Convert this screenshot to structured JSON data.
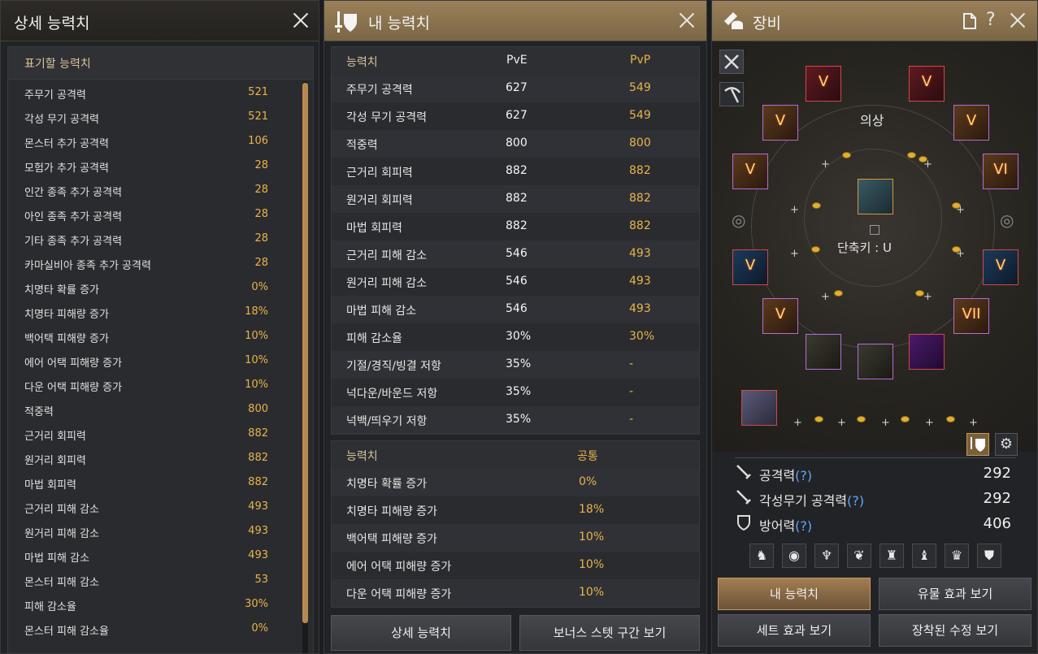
{
  "detail_panel": {
    "title": "상세 능력치",
    "section_label": "표기할 능력치",
    "rows": [
      {
        "name": "주무기 공격력",
        "value": "521"
      },
      {
        "name": "각성 무기 공격력",
        "value": "521"
      },
      {
        "name": "몬스터 추가 공격력",
        "value": "106"
      },
      {
        "name": "모험가 추가 공격력",
        "value": "28"
      },
      {
        "name": "인간 종족 추가 공격력",
        "value": "28"
      },
      {
        "name": "아인 종족 추가 공격력",
        "value": "28"
      },
      {
        "name": "기타 종족 추가 공격력",
        "value": "28"
      },
      {
        "name": "카마실비아 종족 추가 공격력",
        "value": "28"
      },
      {
        "name": "치명타 확률 증가",
        "value": "0%"
      },
      {
        "name": "치명타 피해량 증가",
        "value": "18%"
      },
      {
        "name": "백어택 피해량 증가",
        "value": "10%"
      },
      {
        "name": "에어 어택 피해량 증가",
        "value": "10%"
      },
      {
        "name": "다운 어택 피해량 증가",
        "value": "10%"
      },
      {
        "name": "적중력",
        "value": "800"
      },
      {
        "name": "근거리 회피력",
        "value": "882"
      },
      {
        "name": "원거리 회피력",
        "value": "882"
      },
      {
        "name": "마법 회피력",
        "value": "882"
      },
      {
        "name": "근거리 피해 감소",
        "value": "493"
      },
      {
        "name": "원거리 피해 감소",
        "value": "493"
      },
      {
        "name": "마법 피해 감소",
        "value": "493"
      },
      {
        "name": "몬스터 피해 감소",
        "value": "53"
      },
      {
        "name": "피해 감소율",
        "value": "30%"
      },
      {
        "name": "몬스터 피해 감소율",
        "value": "0%"
      }
    ]
  },
  "stats_panel": {
    "title": "내 능력치",
    "table1": {
      "headers": [
        "능력치",
        "PvE",
        "PvP"
      ],
      "rows": [
        {
          "name": "주무기 공격력",
          "pve": "627",
          "pvp": "549"
        },
        {
          "name": "각성 무기 공격력",
          "pve": "627",
          "pvp": "549"
        },
        {
          "name": "적중력",
          "pve": "800",
          "pvp": "800"
        },
        {
          "name": "근거리 회피력",
          "pve": "882",
          "pvp": "882"
        },
        {
          "name": "원거리 회피력",
          "pve": "882",
          "pvp": "882"
        },
        {
          "name": "마법 회피력",
          "pve": "882",
          "pvp": "882"
        },
        {
          "name": "근거리 피해 감소",
          "pve": "546",
          "pvp": "493"
        },
        {
          "name": "원거리 피해 감소",
          "pve": "546",
          "pvp": "493"
        },
        {
          "name": "마법 피해 감소",
          "pve": "546",
          "pvp": "493"
        },
        {
          "name": "피해 감소율",
          "pve": "30%",
          "pvp": "30%"
        },
        {
          "name": "기절/경직/빙결 저항",
          "pve": "35%",
          "pvp": "-"
        },
        {
          "name": "넉다운/바운드 저항",
          "pve": "35%",
          "pvp": "-"
        },
        {
          "name": "넉백/띄우기 저항",
          "pve": "35%",
          "pvp": "-"
        }
      ]
    },
    "table2": {
      "headers": [
        "능력치",
        "공통"
      ],
      "rows": [
        {
          "name": "치명타 확률 증가",
          "value": "0%"
        },
        {
          "name": "치명타 피해량 증가",
          "value": "18%"
        },
        {
          "name": "백어택 피해량 증가",
          "value": "10%"
        },
        {
          "name": "에어 어택 피해량 증가",
          "value": "10%"
        },
        {
          "name": "다운 어택 피해량 증가",
          "value": "10%"
        }
      ]
    },
    "buttons": {
      "detail": "상세 능력치",
      "bonus": "보너스 스텟 구간 보기"
    }
  },
  "equipment_panel": {
    "title": "장비",
    "costume_label": "의상",
    "shortcut": "단축키 : U",
    "stats": [
      {
        "label": "공격력",
        "help": "(?)",
        "value": "292",
        "icon": "sword-icon"
      },
      {
        "label": "각성무기 공격력",
        "help": "(?)",
        "value": "292",
        "icon": "sword-icon"
      },
      {
        "label": "방어력",
        "help": "(?)",
        "value": "406",
        "icon": "shield-icon"
      }
    ],
    "buttons": {
      "my_stats": "내 능력치",
      "artifact": "유물 효과 보기",
      "set": "세트 효과 보기",
      "equipped": "장착된 수정 보기"
    },
    "slot_grades": [
      "V",
      "V",
      "V",
      "V",
      "V",
      "VI",
      "V",
      "V",
      "V",
      "VII"
    ],
    "colors": {
      "accent": "#e8b44a",
      "help": "#5aa8ff",
      "purple_border": "#b46cd6",
      "red_border": "#d2474a"
    }
  }
}
